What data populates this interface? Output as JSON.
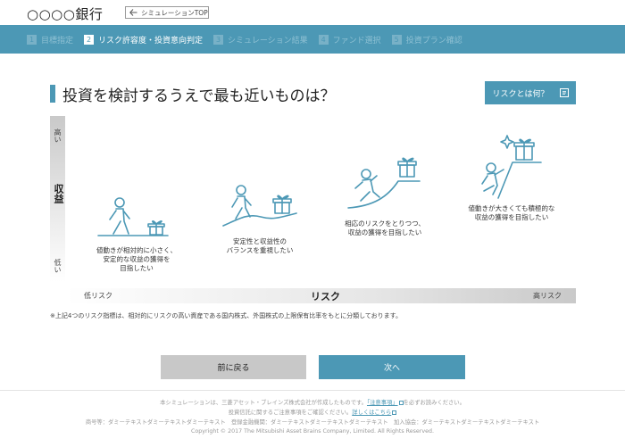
{
  "header": {
    "bank_name": "○○○○銀行",
    "top_link": "シミュレーションTOP"
  },
  "steps": [
    {
      "num": "1",
      "label": "目標指定",
      "active": false
    },
    {
      "num": "2",
      "label": "リスク許容度・投資意向判定",
      "active": true
    },
    {
      "num": "3",
      "label": "シミュレーション結果",
      "active": false
    },
    {
      "num": "4",
      "label": "ファンド選択",
      "active": false
    },
    {
      "num": "5",
      "label": "投資プラン確認",
      "active": false
    }
  ],
  "main": {
    "title": "投資を検討するうえで最も近いものは？",
    "risk_button": "リスクとは何？",
    "vertical_axis": {
      "high": "高い",
      "label": "収益",
      "low": "低い"
    },
    "horizontal_axis": {
      "low": "低リスク",
      "label": "リスク",
      "high": "高リスク"
    },
    "options": [
      {
        "line1": "値動きが相対的に小さく、",
        "line2": "安定的な収益の獲得を",
        "line3": "目指したい"
      },
      {
        "line1": "安定性と収益性の",
        "line2": "バランスを重視したい",
        "line3": ""
      },
      {
        "line1": "相応のリスクをとりつつ、",
        "line2": "収益の獲得を目指したい",
        "line3": ""
      },
      {
        "line1": "値動きが大きくても積極的な",
        "line2": "収益の獲得を目指したい",
        "line3": ""
      }
    ],
    "note": "※上記4つのリスク指標は、相対的にリスクの高い資産である国内株式、外国株式の上限保有比率をもとに分類しております。",
    "back_button": "前に戻る",
    "next_button": "次へ"
  },
  "footer": {
    "line1_text": "本シミュレーションは、三菱アセット・ブレインズ株式会社が作成したものです。",
    "line1_link": "「注意事項」",
    "line1_suffix": "を必ずお読みください。",
    "line2_text": "投資信託に関するご注意事項をご確認ください。",
    "line2_link": "詳しくはこちら",
    "line3": "商号等：ダミーテキストダミーテキストダミーテキスト　登録金融機関：ダミーテキストダミーテキストダミーテキスト　加入協会：ダミーテキストダミーテキストダミーテキスト",
    "copyright": "Copyright © 2017 The Mitsubishi Asset Brains Company, Limited. All Rights Reserved."
  },
  "colors": {
    "accent": "#4c98b5",
    "back_button": "#c8c8c8"
  }
}
